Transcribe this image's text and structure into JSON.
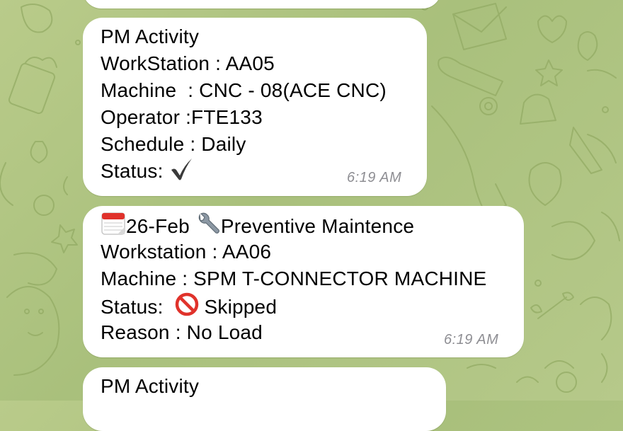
{
  "colors": {
    "background": "#b3c784",
    "bubble": "#ffffff",
    "text": "#000000",
    "timestamp": "#8e8e93",
    "doodle": "#93ab64",
    "checkmark": "#3a3a3a",
    "prohibited": "#e0322b"
  },
  "messages": [
    {
      "lines": [
        "PM Activity",
        "WorkStation : AA05",
        "Machine  : CNC - 08(ACE CNC)",
        "Operator :FTE133",
        "Schedule : Daily"
      ],
      "status_label": "Status: ",
      "status_icon": "checkmark-icon",
      "time": "6:19 AM"
    },
    {
      "date": "26-Feb",
      "date_icon": "calendar-icon",
      "title": "Preventive Maintence",
      "title_icon": "wrench-icon",
      "lines": [
        "Workstation : AA06",
        "Machine : SPM T-CONNECTOR MACHINE"
      ],
      "status_label": "Status:  ",
      "status_icon": "prohibited-icon",
      "status_text": " Skipped",
      "reason": "Reason : No Load",
      "time": "6:19 AM"
    },
    {
      "lines": [
        "PM Activity"
      ]
    }
  ]
}
